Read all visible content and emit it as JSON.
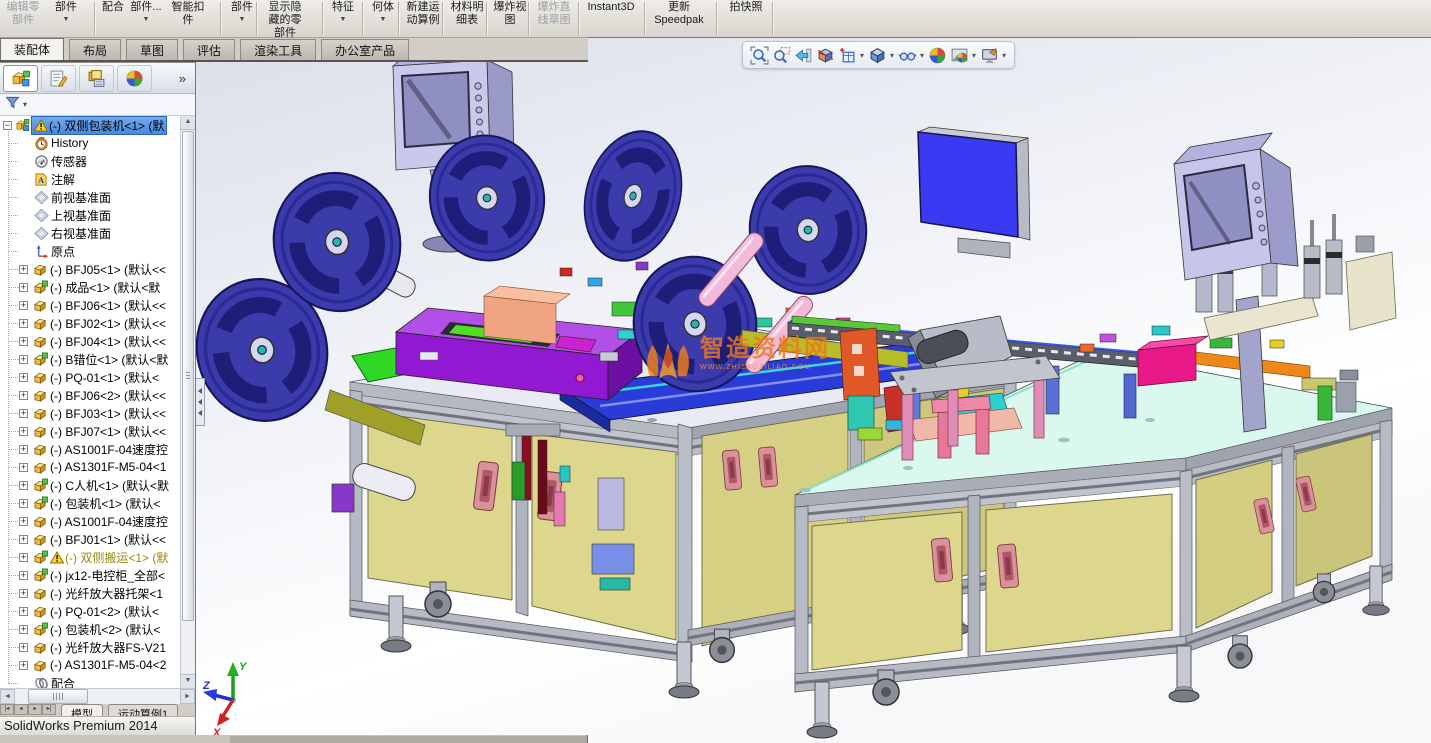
{
  "window": {
    "status": "SolidWorks Premium 2014"
  },
  "ribbon": {
    "items": [
      {
        "lines": [
          "编辑零",
          "部件"
        ],
        "disabled": true,
        "arrow": false
      },
      {
        "lines": [
          "部件"
        ],
        "disabled": false,
        "arrow": true
      },
      {
        "lines": [
          "配合"
        ],
        "disabled": false,
        "arrow": false
      },
      {
        "lines": [
          "部件..."
        ],
        "disabled": false,
        "arrow": true
      },
      {
        "lines": [
          "智能扣",
          "件"
        ],
        "disabled": false,
        "arrow": false
      },
      {
        "lines": [
          "部件"
        ],
        "disabled": false,
        "arrow": true
      },
      {
        "lines": [
          "显示隐",
          "藏的零",
          "部件"
        ],
        "disabled": false,
        "arrow": false
      },
      {
        "lines": [
          "特征"
        ],
        "disabled": false,
        "arrow": true
      },
      {
        "lines": [
          "何体"
        ],
        "disabled": false,
        "arrow": true
      },
      {
        "lines": [
          "新建运",
          "动算例"
        ],
        "disabled": false,
        "arrow": false
      },
      {
        "lines": [
          "材料明",
          "细表"
        ],
        "disabled": false,
        "arrow": false
      },
      {
        "lines": [
          "爆炸视",
          "图"
        ],
        "disabled": false,
        "arrow": false
      },
      {
        "lines": [
          "爆炸直",
          "线草图"
        ],
        "disabled": true,
        "arrow": false
      },
      {
        "lines": [
          "Instant3D"
        ],
        "disabled": false,
        "arrow": false
      },
      {
        "lines": [
          "更新",
          "Speedpak"
        ],
        "disabled": false,
        "arrow": false
      },
      {
        "lines": [
          "拍快照"
        ],
        "disabled": false,
        "arrow": false
      }
    ],
    "tabs": [
      {
        "label": "装配体",
        "active": true
      },
      {
        "label": "布局",
        "active": false
      },
      {
        "label": "草图",
        "active": false
      },
      {
        "label": "评估",
        "active": false
      },
      {
        "label": "渲染工具",
        "active": false
      },
      {
        "label": "办公室产品",
        "active": false
      }
    ]
  },
  "headsup": {
    "icons": [
      {
        "name": "zoom-fit",
        "arrow": false
      },
      {
        "name": "zoom-area",
        "arrow": false
      },
      {
        "name": "previous-view",
        "arrow": false
      },
      {
        "name": "section-view",
        "arrow": false
      },
      {
        "name": "view-orientation",
        "arrow": true
      },
      {
        "name": "display-style",
        "arrow": true
      },
      {
        "name": "hide-show-items",
        "arrow": true
      },
      {
        "name": "edit-appearance",
        "arrow": false
      },
      {
        "name": "apply-scene",
        "arrow": true
      },
      {
        "name": "view-settings",
        "arrow": true
      }
    ]
  },
  "panel": {
    "tabs": [
      "feature-manager",
      "property-manager",
      "configuration-manager",
      "display-manager"
    ],
    "overflow": "»",
    "tree": [
      {
        "text": "(-) 双侧包装机<1> (默",
        "icon": "assembly",
        "expand": "minus",
        "warn": true,
        "selected": true
      },
      {
        "text": "History",
        "icon": "history"
      },
      {
        "text": "传感器",
        "icon": "sensor"
      },
      {
        "text": "注解",
        "icon": "annotations"
      },
      {
        "text": "前视基准面",
        "icon": "plane"
      },
      {
        "text": "上视基准面",
        "icon": "plane"
      },
      {
        "text": "右视基准面",
        "icon": "plane"
      },
      {
        "text": "原点",
        "icon": "origin"
      },
      {
        "text": "(-) BFJ05<1> (默认<<",
        "icon": "part-y",
        "expand": "plus"
      },
      {
        "text": "(-) 成品<1> (默认<默",
        "icon": "part-g",
        "expand": "plus"
      },
      {
        "text": "(-) BFJ06<1> (默认<<",
        "icon": "part-y",
        "expand": "plus"
      },
      {
        "text": "(-) BFJ02<1> (默认<<",
        "icon": "part-y",
        "expand": "plus"
      },
      {
        "text": "(-) BFJ04<1> (默认<<",
        "icon": "part-y",
        "expand": "plus"
      },
      {
        "text": "(-) B错位<1> (默认<默",
        "icon": "part-g",
        "expand": "plus"
      },
      {
        "text": "(-) PQ-01<1> (默认<",
        "icon": "part-y",
        "expand": "plus"
      },
      {
        "text": "(-) BFJ06<2> (默认<<",
        "icon": "part-y",
        "expand": "plus"
      },
      {
        "text": "(-) BFJ03<1> (默认<<",
        "icon": "part-y",
        "expand": "plus"
      },
      {
        "text": "(-) BFJ07<1> (默认<<",
        "icon": "part-y",
        "expand": "plus"
      },
      {
        "text": "(-) AS1001F-04速度控",
        "icon": "part-y",
        "expand": "plus"
      },
      {
        "text": "(-) AS1301F-M5-04<1",
        "icon": "part-y",
        "expand": "plus"
      },
      {
        "text": "(-) C人机<1> (默认<默",
        "icon": "part-g",
        "expand": "plus"
      },
      {
        "text": "(-) 包装机<1> (默认<",
        "icon": "part-g",
        "expand": "plus"
      },
      {
        "text": "(-) AS1001F-04速度控",
        "icon": "part-y",
        "expand": "plus"
      },
      {
        "text": "(-) BFJ01<1> (默认<<",
        "icon": "part-y",
        "expand": "plus"
      },
      {
        "text": "(-) 双侧搬运<1> (默",
        "icon": "part-g",
        "expand": "plus",
        "warn": true,
        "muted": true
      },
      {
        "text": "(-) jx12-电控柜_全部<",
        "icon": "part-g",
        "expand": "plus"
      },
      {
        "text": "(-) 光纤放大器托架<1",
        "icon": "part-y",
        "expand": "plus"
      },
      {
        "text": "(-) PQ-01<2> (默认<",
        "icon": "part-y",
        "expand": "plus"
      },
      {
        "text": "(-) 包装机<2> (默认<",
        "icon": "part-g",
        "expand": "plus"
      },
      {
        "text": "(-) 光纤放大器FS-V21",
        "icon": "part-y",
        "expand": "plus"
      },
      {
        "text": "(-) AS1301F-M5-04<2",
        "icon": "part-y",
        "expand": "plus"
      },
      {
        "text": "配合",
        "icon": "mates"
      }
    ]
  },
  "motion": {
    "tabs": [
      {
        "label": "模型",
        "active": true
      },
      {
        "label": "运动算例1",
        "active": false
      }
    ]
  },
  "watermark": {
    "title": "智造资料网",
    "subtitle": "WWW.ZHIZAOZILIAO.COM"
  },
  "triad": {
    "x": "X",
    "y": "Y",
    "z": "Z"
  }
}
